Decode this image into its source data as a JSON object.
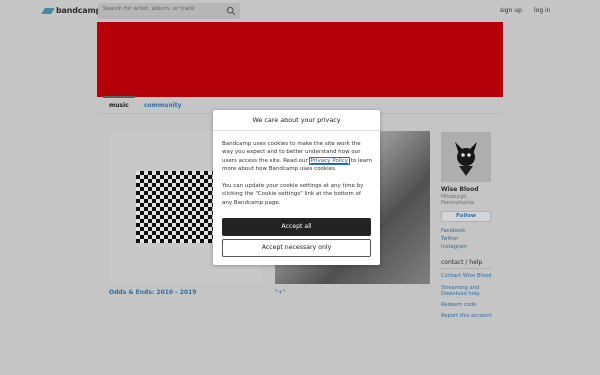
{
  "header": {
    "logo_text": "bandcamp",
    "search_placeholder": "Search for artist, album, or track",
    "signup_label": "sign up",
    "login_label": "log in"
  },
  "colors": {
    "banner": "#c20009",
    "link": "#2e77b8",
    "logo_mark": "#4e95b0"
  },
  "tabs": {
    "music": "music",
    "community": "community"
  },
  "content": {
    "album_title": "Odds & Ends: 2010 - 2019",
    "second_title": "\"+\""
  },
  "sidebar": {
    "artist_name": "Wise Blood",
    "location": "Pittsburgh, Pennsylvania",
    "follow_label": "Follow",
    "links": [
      "Facebook",
      "Twitter",
      "Instagram"
    ],
    "contact_heading": "contact / help",
    "contact_links": [
      "Contact Wise Blood",
      "Streaming and Download help",
      "Redeem code",
      "Report this account"
    ]
  },
  "cookie_dialog": {
    "title": "We care about your privacy",
    "p1_before": "Bandcamp uses cookies to make the site work the way you expect and to better understand how our users access the site. Read our ",
    "p1_link": "Privacy Policy",
    "p1_after": " to learn more about how Bandcamp uses cookies.",
    "p2": "You can update your cookie settings at any time by clicking the \"Cookie settings\" link at the bottom of any Bandcamp page.",
    "accept_all": "Accept all",
    "accept_necessary": "Accept necessary only"
  }
}
